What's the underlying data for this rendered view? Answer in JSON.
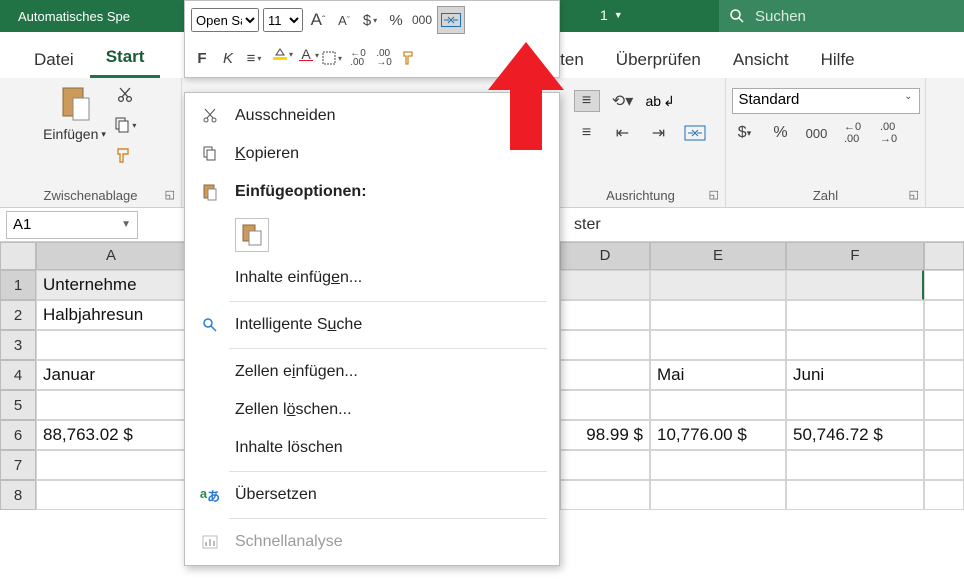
{
  "title_bar": {
    "autosave": "Automatisches Spe",
    "tab_number": "1",
    "search_placeholder": "Suchen"
  },
  "mini": {
    "font": "Open Sa",
    "size": "11",
    "inc_font": "A",
    "dec_font": "A",
    "currency": "$",
    "percent": "%",
    "thousands": "000"
  },
  "tabs": {
    "file": "Datei",
    "home": "Start",
    "data": "Daten",
    "review": "Überprüfen",
    "view": "Ansicht",
    "help": "Hilfe"
  },
  "ribbon": {
    "paste": "Einfügen",
    "clipboard_label": "Zwischenablage",
    "alignment_label": "Ausrichtung",
    "number_label": "Zahl",
    "number_format": "Standard",
    "wrap": "ab"
  },
  "context": {
    "cut": "Ausschneiden",
    "copy": "Kopieren",
    "paste_options": "Einfügeoptionen:",
    "paste_special": "Inhalte einfügen...",
    "smart_lookup": "Intelligente Suche",
    "insert_cells": "Zellen einfügen...",
    "delete_cells": "Zellen löschen...",
    "clear_contents": "Inhalte löschen",
    "translate": "Übersetzen",
    "quick_analysis": "Schnellanalyse"
  },
  "fbar": {
    "name": "A1",
    "text": "ster"
  },
  "cols": [
    "A",
    "",
    "D",
    "E",
    "F",
    ""
  ],
  "cells": {
    "a1": "Unternehme",
    "a2": "Halbjahresun",
    "a4": "Januar",
    "e4": "Mai",
    "f4": "Juni",
    "a6": "88,763.02 $",
    "d6": "98.99 $",
    "e6": "10,776.00 $",
    "f6": "50,746.72 $"
  }
}
